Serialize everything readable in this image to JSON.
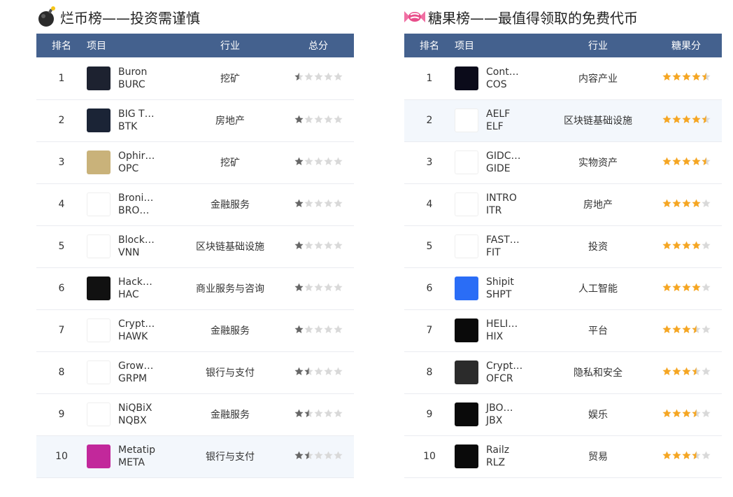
{
  "colors": {
    "header_bg": "#44618e",
    "star_dark": "#666666",
    "star_gold": "#f5a623",
    "star_empty": "#d9d9d9"
  },
  "left_panel": {
    "title": "烂币榜——投资需谨慎",
    "icon": "bomb-icon",
    "headers": [
      "排名",
      "项目",
      "行业",
      "总分"
    ],
    "star_style": "dark",
    "rows": [
      {
        "rank": "1",
        "name": "Buron",
        "symbol": "BURC",
        "industry": "挖矿",
        "rating": 0.5,
        "logo_icon": "buron-logo-icon",
        "logo_color": "#1d2230"
      },
      {
        "rank": "2",
        "name": "BIG T…",
        "symbol": "BTK",
        "industry": "房地产",
        "rating": 1,
        "logo_icon": "bigtoken-logo-icon",
        "logo_color": "#1b2436"
      },
      {
        "rank": "3",
        "name": "Ophir…",
        "symbol": "OPC",
        "industry": "挖矿",
        "rating": 1,
        "logo_icon": "ophir-logo-icon",
        "logo_color": "#c9b27a"
      },
      {
        "rank": "4",
        "name": "Broni…",
        "symbol": "BRO…",
        "industry": "金融服务",
        "rating": 1,
        "logo_icon": "bronix-logo-icon",
        "logo_color": "#ffffff"
      },
      {
        "rank": "5",
        "name": "Block…",
        "symbol": "VNN",
        "industry": "区块链基础设施",
        "rating": 1,
        "logo_icon": "vnn-logo-icon",
        "logo_color": "#ffffff"
      },
      {
        "rank": "6",
        "name": "Hack…",
        "symbol": "HAC",
        "industry": "商业服务与咨询",
        "rating": 1,
        "logo_icon": "hackspace-logo-icon",
        "logo_color": "#111111"
      },
      {
        "rank": "7",
        "name": "Crypt…",
        "symbol": "HAWK",
        "industry": "金融服务",
        "rating": 1,
        "logo_icon": "cryptohawk-logo-icon",
        "logo_color": "#ffffff"
      },
      {
        "rank": "8",
        "name": "Grow…",
        "symbol": "GRPM",
        "industry": "银行与支付",
        "rating": 1.5,
        "logo_icon": "grow-logo-icon",
        "logo_color": "#ffffff"
      },
      {
        "rank": "9",
        "name": "NiQBiX",
        "symbol": "NQBX",
        "industry": "金融服务",
        "rating": 1.5,
        "logo_icon": "niqbix-logo-icon",
        "logo_color": "#ffffff"
      },
      {
        "rank": "10",
        "name": "Metatip",
        "symbol": "META",
        "industry": "银行与支付",
        "rating": 1.5,
        "logo_icon": "metatip-logo-icon",
        "logo_color": "#c2289b"
      }
    ]
  },
  "right_panel": {
    "title": "糖果榜——最值得领取的免费代币",
    "icon": "candy-icon",
    "headers": [
      "排名",
      "项目",
      "行业",
      "糖果分"
    ],
    "star_style": "gold",
    "rows": [
      {
        "rank": "1",
        "name": "Cont…",
        "symbol": "COS",
        "industry": "内容产业",
        "rating": 4.5,
        "logo_icon": "contentos-logo-icon",
        "logo_color": "#0b0b1a"
      },
      {
        "rank": "2",
        "name": "AELF",
        "symbol": "ELF",
        "industry": "区块链基础设施",
        "rating": 4.5,
        "logo_icon": "aelf-logo-icon",
        "logo_color": "#ffffff"
      },
      {
        "rank": "3",
        "name": "GIDC…",
        "symbol": "GIDE",
        "industry": "实物资产",
        "rating": 4.5,
        "logo_icon": "gidcoin-logo-icon",
        "logo_color": "#ffffff"
      },
      {
        "rank": "4",
        "name": "INTRO",
        "symbol": "ITR",
        "industry": "房地产",
        "rating": 4,
        "logo_icon": "intro-logo-icon",
        "logo_color": "#ffffff"
      },
      {
        "rank": "5",
        "name": "FAST…",
        "symbol": "FIT",
        "industry": "投资",
        "rating": 4,
        "logo_icon": "fastinvest-logo-icon",
        "logo_color": "#ffffff"
      },
      {
        "rank": "6",
        "name": "Shipit",
        "symbol": "SHPT",
        "industry": "人工智能",
        "rating": 4,
        "logo_icon": "shipit-logo-icon",
        "logo_color": "#2a6df6"
      },
      {
        "rank": "7",
        "name": "HELI…",
        "symbol": "HIX",
        "industry": "平台",
        "rating": 3.5,
        "logo_icon": "helix-logo-icon",
        "logo_color": "#0a0a0a"
      },
      {
        "rank": "8",
        "name": "Crypt…",
        "symbol": "OFCR",
        "industry": "隐私和安全",
        "rating": 3.5,
        "logo_icon": "cryptopolice-logo-icon",
        "logo_color": "#2b2b2b"
      },
      {
        "rank": "9",
        "name": "JBO…",
        "symbol": "JBX",
        "industry": "娱乐",
        "rating": 3.5,
        "logo_icon": "jboxcoin-logo-icon",
        "logo_color": "#0a0a0a"
      },
      {
        "rank": "10",
        "name": "Railz",
        "symbol": "RLZ",
        "industry": "贸易",
        "rating": 3.5,
        "logo_icon": "railz-logo-icon",
        "logo_color": "#0a0a0a"
      }
    ]
  }
}
